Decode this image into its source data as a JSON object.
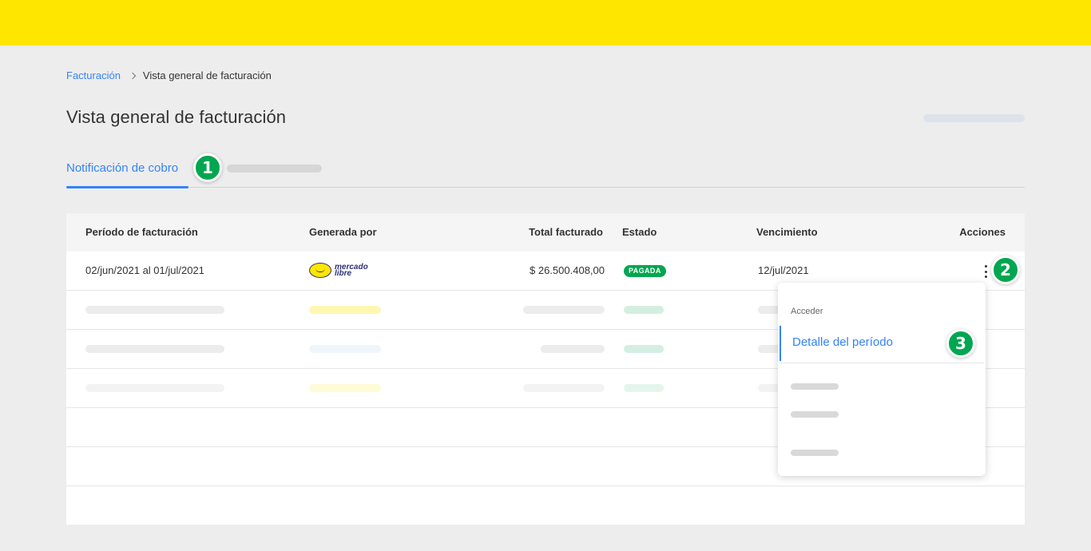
{
  "breadcrumb": {
    "link": "Facturación",
    "current": "Vista general de facturación"
  },
  "page": {
    "title": "Vista general de facturación"
  },
  "tabs": {
    "active_label": "Notificación de cobro"
  },
  "steps": {
    "one": "1",
    "two": "2",
    "three": "3"
  },
  "table": {
    "headers": {
      "period": "Período de facturación",
      "generated_by": "Generada por",
      "total": "Total facturado",
      "status": "Estado",
      "due": "Vencimiento",
      "actions": "Acciones"
    },
    "row": {
      "period": "02/jun/2021 al 01/jul/2021",
      "generated_by_logo": "mercado libre",
      "total": "$ 26.500.408,00",
      "status": "PAGADA",
      "due": "12/jul/2021"
    }
  },
  "menu": {
    "section_title": "Acceder",
    "active_item": "Detalle del período"
  },
  "colors": {
    "topbar": "#ffe600",
    "accent": "#3483fa",
    "success": "#00a650"
  }
}
